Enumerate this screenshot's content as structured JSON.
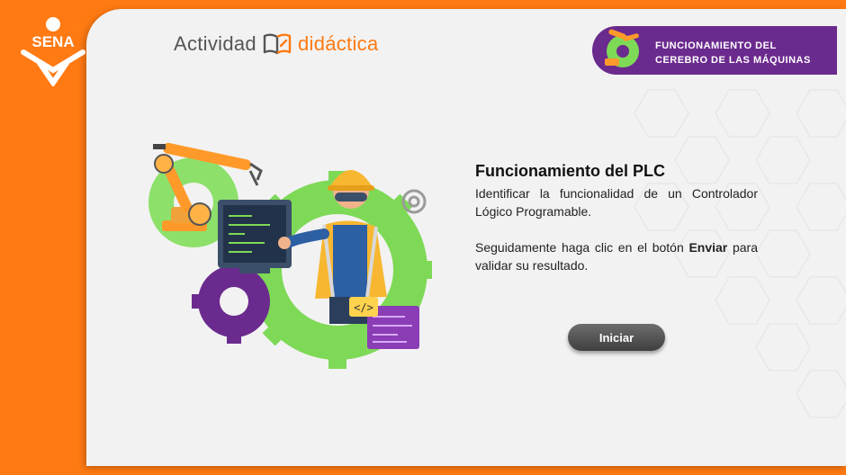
{
  "brand": {
    "logo_text": "SENA",
    "activity_label": "Actividad",
    "didactic_label": "didáctica"
  },
  "topic": {
    "line1": "FUNCIONAMIENTO DEL",
    "line2": "CEREBRO DE LAS MÁQUINAS"
  },
  "content": {
    "title": "Funcionamiento del PLC",
    "intro": "Identificar la funcionalidad de un Controlador Lógico Programable.",
    "instruction_prefix": "Seguidamente haga clic en el botón ",
    "instruction_bold": "Enviar",
    "instruction_suffix": " para validar su resultado."
  },
  "actions": {
    "start_label": "Iniciar"
  },
  "colors": {
    "orange": "#ff7a12",
    "purple": "#6b2a8e",
    "green": "#7ed957",
    "button": "#4a4a4a"
  },
  "icons": [
    "sena-logo",
    "book-icon",
    "robot-arm-icon",
    "gear-icon",
    "engineer-illustration",
    "code-icon"
  ]
}
